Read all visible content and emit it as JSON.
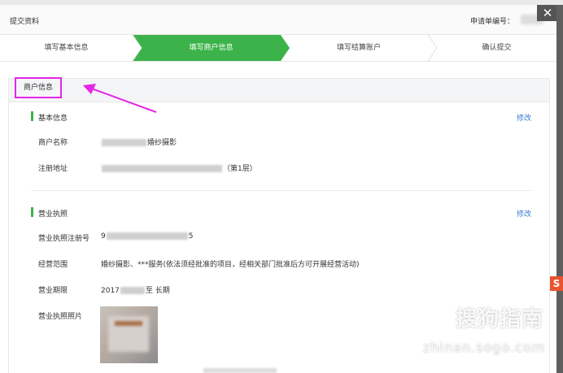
{
  "dialog": {
    "title": "提交资料",
    "application_no_label": "申请单编号：",
    "close_icon": "✕"
  },
  "steps": [
    {
      "label": "填写基本信息",
      "active": false
    },
    {
      "label": "填写商户信息",
      "active": true
    },
    {
      "label": "填写结算账户",
      "active": false
    },
    {
      "label": "确认提交",
      "active": false
    }
  ],
  "section": {
    "title": "商户信息"
  },
  "basic_info": {
    "title": "基本信息",
    "edit": "修改",
    "merchant_name_label": "商户名称",
    "merchant_name_suffix": "婚纱摄影",
    "address_label": "注册地址",
    "address_suffix": "（第1层）"
  },
  "business_license": {
    "title": "营业执照",
    "edit": "修改",
    "reg_no_label": "营业执照注册号",
    "reg_no_prefix": "9",
    "reg_no_suffix": "5",
    "scope_label": "经营范围",
    "scope_value": "婚纱摄影、***服务(依法须经批准的项目，经相关部门批准后方可开展经营活动)",
    "term_label": "营业期限",
    "term_start_prefix": "2017",
    "term_end": "至 长期",
    "photo_label": "营业执照照片"
  },
  "watermark": {
    "logo": "S",
    "text": "搜狗指南",
    "url": "zhinan.sogo.com"
  },
  "colors": {
    "step_active": "#3cb34a",
    "highlight": "#e626e6",
    "link": "#3a7dd1"
  }
}
